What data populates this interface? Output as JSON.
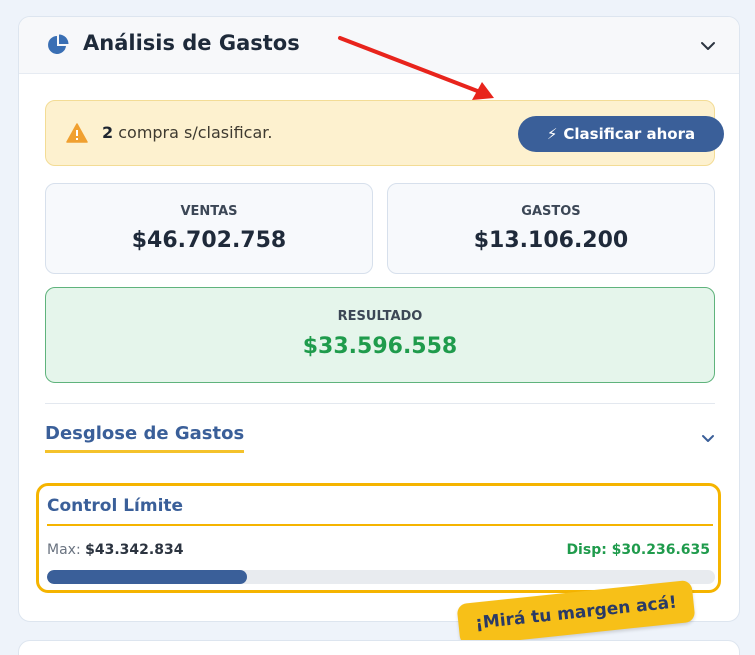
{
  "header": {
    "title": "Análisis de Gastos",
    "icon": "pie-chart-icon"
  },
  "alert": {
    "count": "2",
    "text": " compra s/clasificar.",
    "button_label": "Clasificar ahora"
  },
  "stats": {
    "ventas": {
      "label": "VENTAS",
      "value": "$46.702.758"
    },
    "gastos": {
      "label": "GASTOS",
      "value": "$13.106.200"
    },
    "resultado": {
      "label": "RESULTADO",
      "value": "$33.596.558"
    }
  },
  "breakdown": {
    "title": "Desglose de Gastos"
  },
  "limit": {
    "title": "Control Límite",
    "max_label": "Max: ",
    "max_value": "$43.342.834",
    "disp": "Disp: $30.236.635",
    "progress_percent": 30
  },
  "sticker": {
    "text": "¡Mirá tu margen acá!"
  },
  "colors": {
    "primary": "#3a5f99",
    "accent": "#f5b400",
    "positive": "#1f9b4c",
    "warning_bg": "#fdf1cf",
    "annotation_arrow": "#e8241c"
  }
}
